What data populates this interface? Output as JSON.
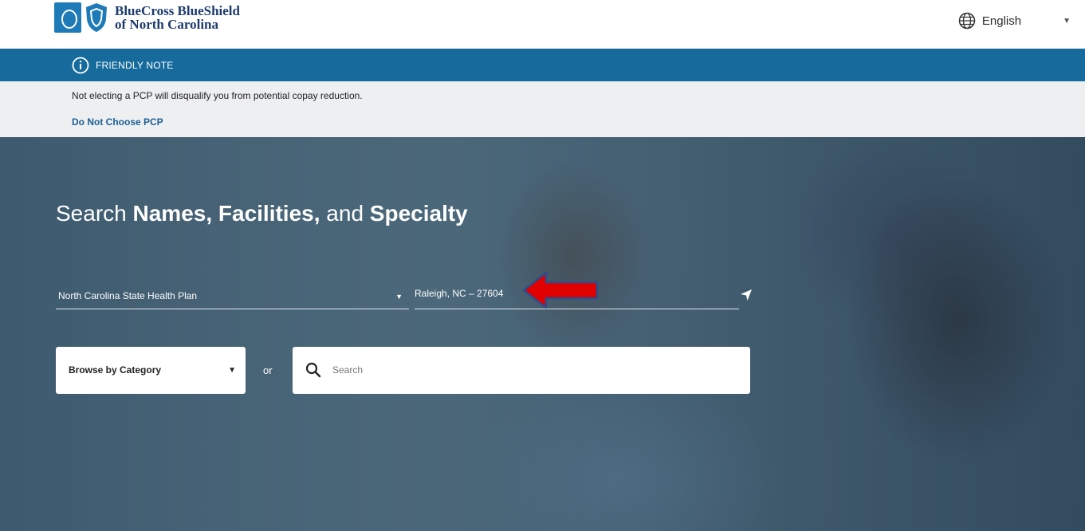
{
  "brand": {
    "name_line1": "BlueCross BlueShield",
    "name_line2": "of North Carolina"
  },
  "language": {
    "label": "English",
    "icon": "globe-icon"
  },
  "friendly_note": {
    "title": "FRIENDLY NOTE",
    "message": "Not electing a PCP will disqualify you from potential copay reduction.",
    "link": "Do Not Choose PCP"
  },
  "hero": {
    "title_plain1": "Search ",
    "title_bold1": "Names, Facilities,",
    "title_plain2": " and ",
    "title_bold2": "Specialty"
  },
  "plan_select": {
    "value": "North Carolina State Health Plan"
  },
  "location": {
    "value": "Raleigh, NC – 27604"
  },
  "browse": {
    "label": "Browse by Category"
  },
  "or_label": "or",
  "search": {
    "placeholder": "Search"
  },
  "colors": {
    "note_bar": "#166b9c",
    "note_body": "#eeeff1",
    "link": "#1a5f95",
    "annotation_arrow": "#e00000"
  }
}
